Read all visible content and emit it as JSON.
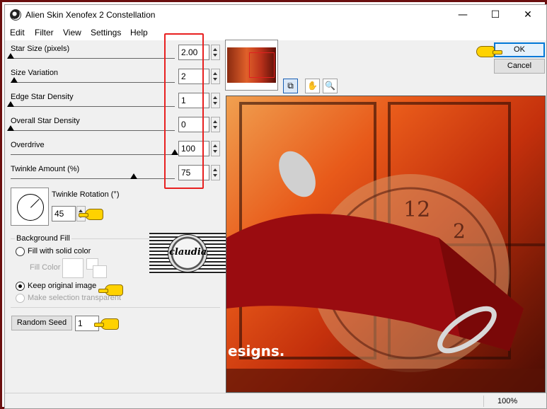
{
  "window": {
    "title": "Alien Skin Xenofex 2 Constellation",
    "controls": {
      "minimize": "—",
      "maximize": "☐",
      "close": "✕"
    }
  },
  "menu": [
    "Edit",
    "Filter",
    "View",
    "Settings",
    "Help"
  ],
  "parameters": [
    {
      "label": "Star Size (pixels)",
      "value": "2.00",
      "level": 0.0
    },
    {
      "label": "Size Variation",
      "value": "2",
      "level": 0.02
    },
    {
      "label": "Edge Star Density",
      "value": "1",
      "level": 0.0
    },
    {
      "label": "Overall Star Density",
      "value": "0",
      "level": 0.0
    },
    {
      "label": "Overdrive",
      "value": "100",
      "level": 1.0
    },
    {
      "label": "Twinkle Amount (%)",
      "value": "75",
      "level": 0.75
    }
  ],
  "twinkle_rotation": {
    "label": "Twinkle Rotation (°)",
    "value": "45"
  },
  "background_fill": {
    "label": "Background Fill",
    "options": [
      {
        "label": "Fill with solid color",
        "selected": false,
        "enabled": true
      },
      {
        "label": "Keep original image",
        "selected": true,
        "enabled": true
      },
      {
        "label": "Make selection transparent",
        "selected": false,
        "enabled": false
      }
    ],
    "fill_color_label": "Fill Color"
  },
  "random_seed": {
    "button_label": "Random Seed",
    "value": "1"
  },
  "buttons": {
    "ok": "OK",
    "cancel": "Cancel"
  },
  "tools": [
    {
      "name": "preview-toggle-icon",
      "glyph": "⧉"
    },
    {
      "name": "hand-icon",
      "glyph": "✋"
    },
    {
      "name": "zoom-icon",
      "glyph": "🔍"
    }
  ],
  "watermark": {
    "text": "claudia"
  },
  "preview": {
    "caption": "esigns."
  },
  "status": {
    "zoom": "100%"
  },
  "colors": {
    "highlight_box": "#e82020",
    "pointer": "#ffd200",
    "accent": "#0078d7"
  }
}
